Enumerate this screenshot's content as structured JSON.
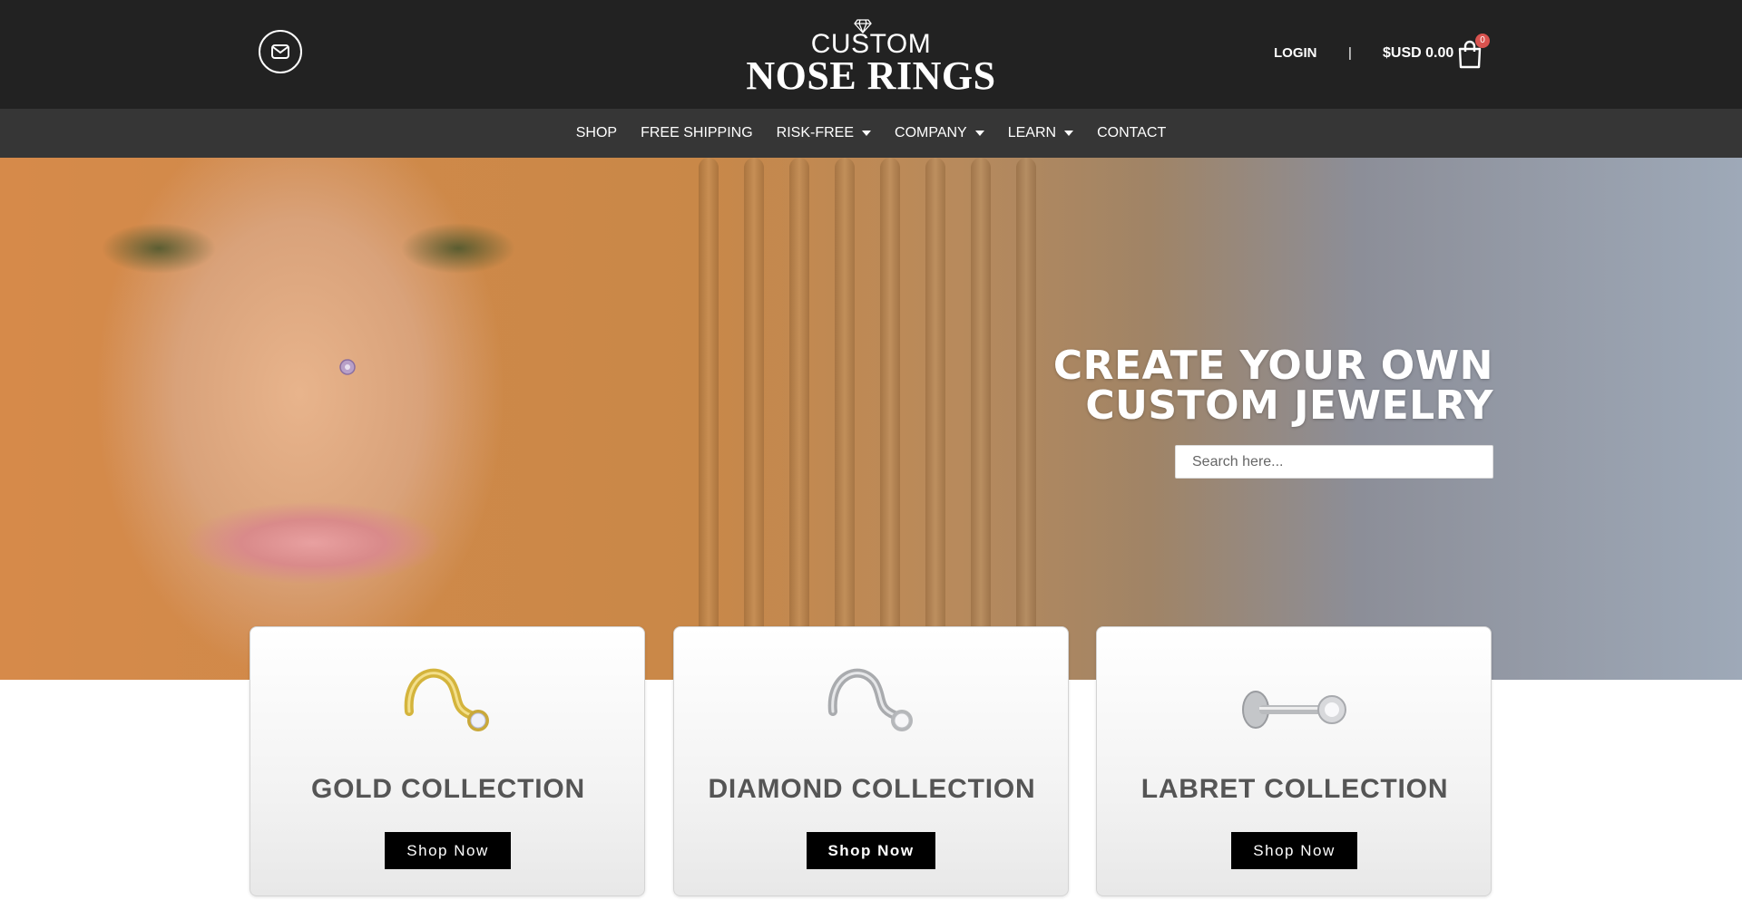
{
  "header": {
    "logo": {
      "line1": "CUSTOM",
      "line2": "NOSE RINGS"
    },
    "mail_icon": "envelope-icon",
    "login_label": "LOGIN",
    "separator": "|",
    "cart": {
      "price": "$USD 0.00",
      "count": "0",
      "icon": "shopping-bag-icon"
    }
  },
  "nav": {
    "items": [
      {
        "label": "SHOP",
        "has_dropdown": false
      },
      {
        "label": "FREE SHIPPING",
        "has_dropdown": false
      },
      {
        "label": "RISK-FREE",
        "has_dropdown": true
      },
      {
        "label": "COMPANY",
        "has_dropdown": true
      },
      {
        "label": "LEARN",
        "has_dropdown": true
      },
      {
        "label": "CONTACT",
        "has_dropdown": false
      }
    ]
  },
  "hero": {
    "headline_line1": "CREATE YOUR OWN",
    "headline_line2": "CUSTOM JEWELRY",
    "search_placeholder": "Search here..."
  },
  "collections": [
    {
      "title": "GOLD COLLECTION",
      "button": "Shop Now",
      "image": "gold-nose-screw"
    },
    {
      "title": "DIAMOND COLLECTION",
      "button": "Shop Now",
      "image": "silver-nose-screw"
    },
    {
      "title": "LABRET COLLECTION",
      "button": "Shop Now",
      "image": "labret-stud"
    }
  ],
  "colors": {
    "header_bg": "#222222",
    "nav_bg": "#363636",
    "button_bg": "#000000",
    "badge": "#d9534f",
    "card_title": "#555555"
  }
}
